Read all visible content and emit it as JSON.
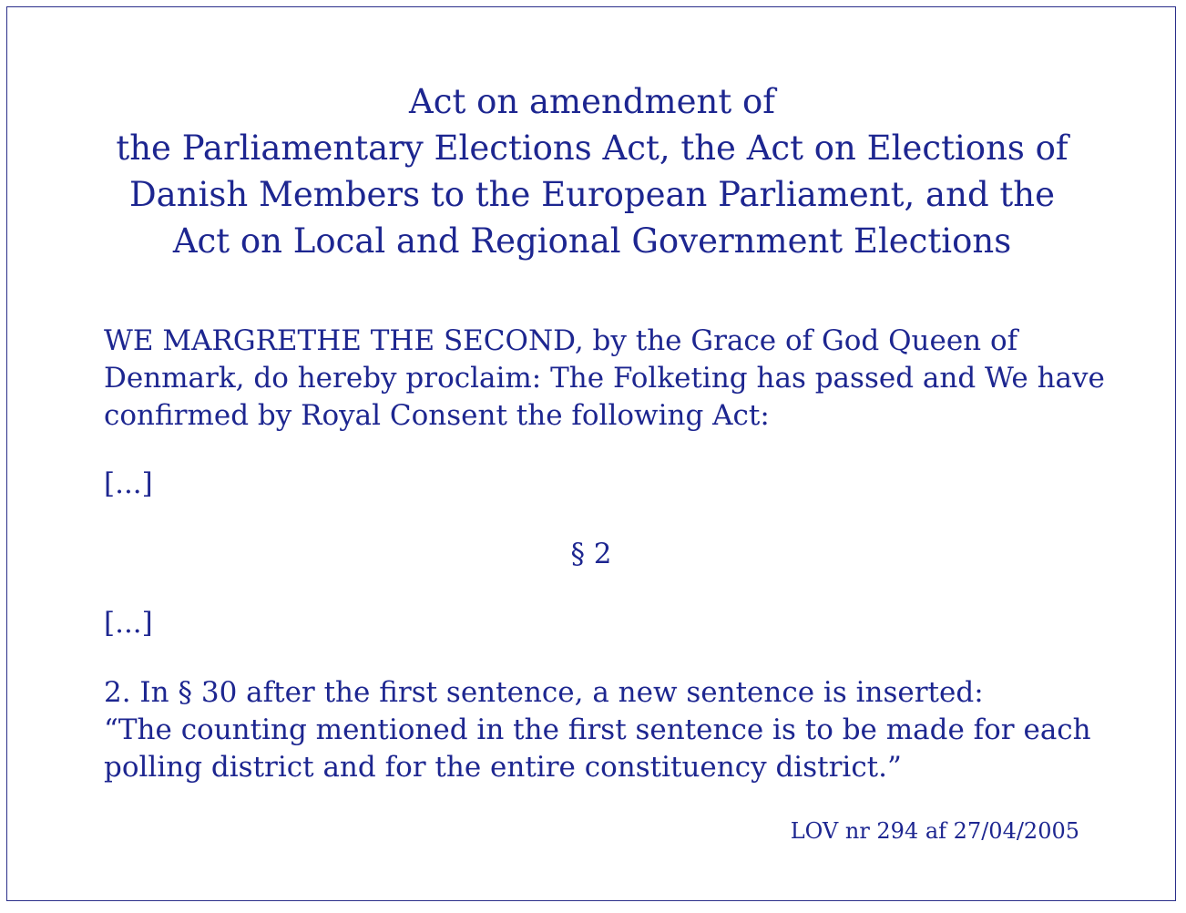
{
  "title": {
    "lines": [
      "Act on amendment of",
      "the Parliamentary Elections Act, the Act on Elections of",
      "Danish Members to the European Parliament, and the",
      "Act on Local and Regional Government Elections"
    ]
  },
  "proclamation": {
    "lines": [
      "WE MARGRETHE THE SECOND, by the Grace of God Queen of",
      "Denmark, do hereby proclaim: The Folketing has passed  and We have",
      "confirmed by Royal Consent the following Act:"
    ]
  },
  "ellipsis_first": "[...]",
  "section_heading": "§ 2",
  "ellipsis_second": "[...]",
  "amendment": {
    "lines": [
      "2. In § 30 after the first sentence, a new sentence is inserted:",
      "“The counting mentioned in the first sentence is to be made for each",
      "polling district and for the entire constituency district.”"
    ]
  },
  "reference": "LOV nr 294 af 27/04/2005",
  "colors": {
    "text": "#1d2690",
    "border": "#2b2f8a",
    "background": "#ffffff"
  }
}
